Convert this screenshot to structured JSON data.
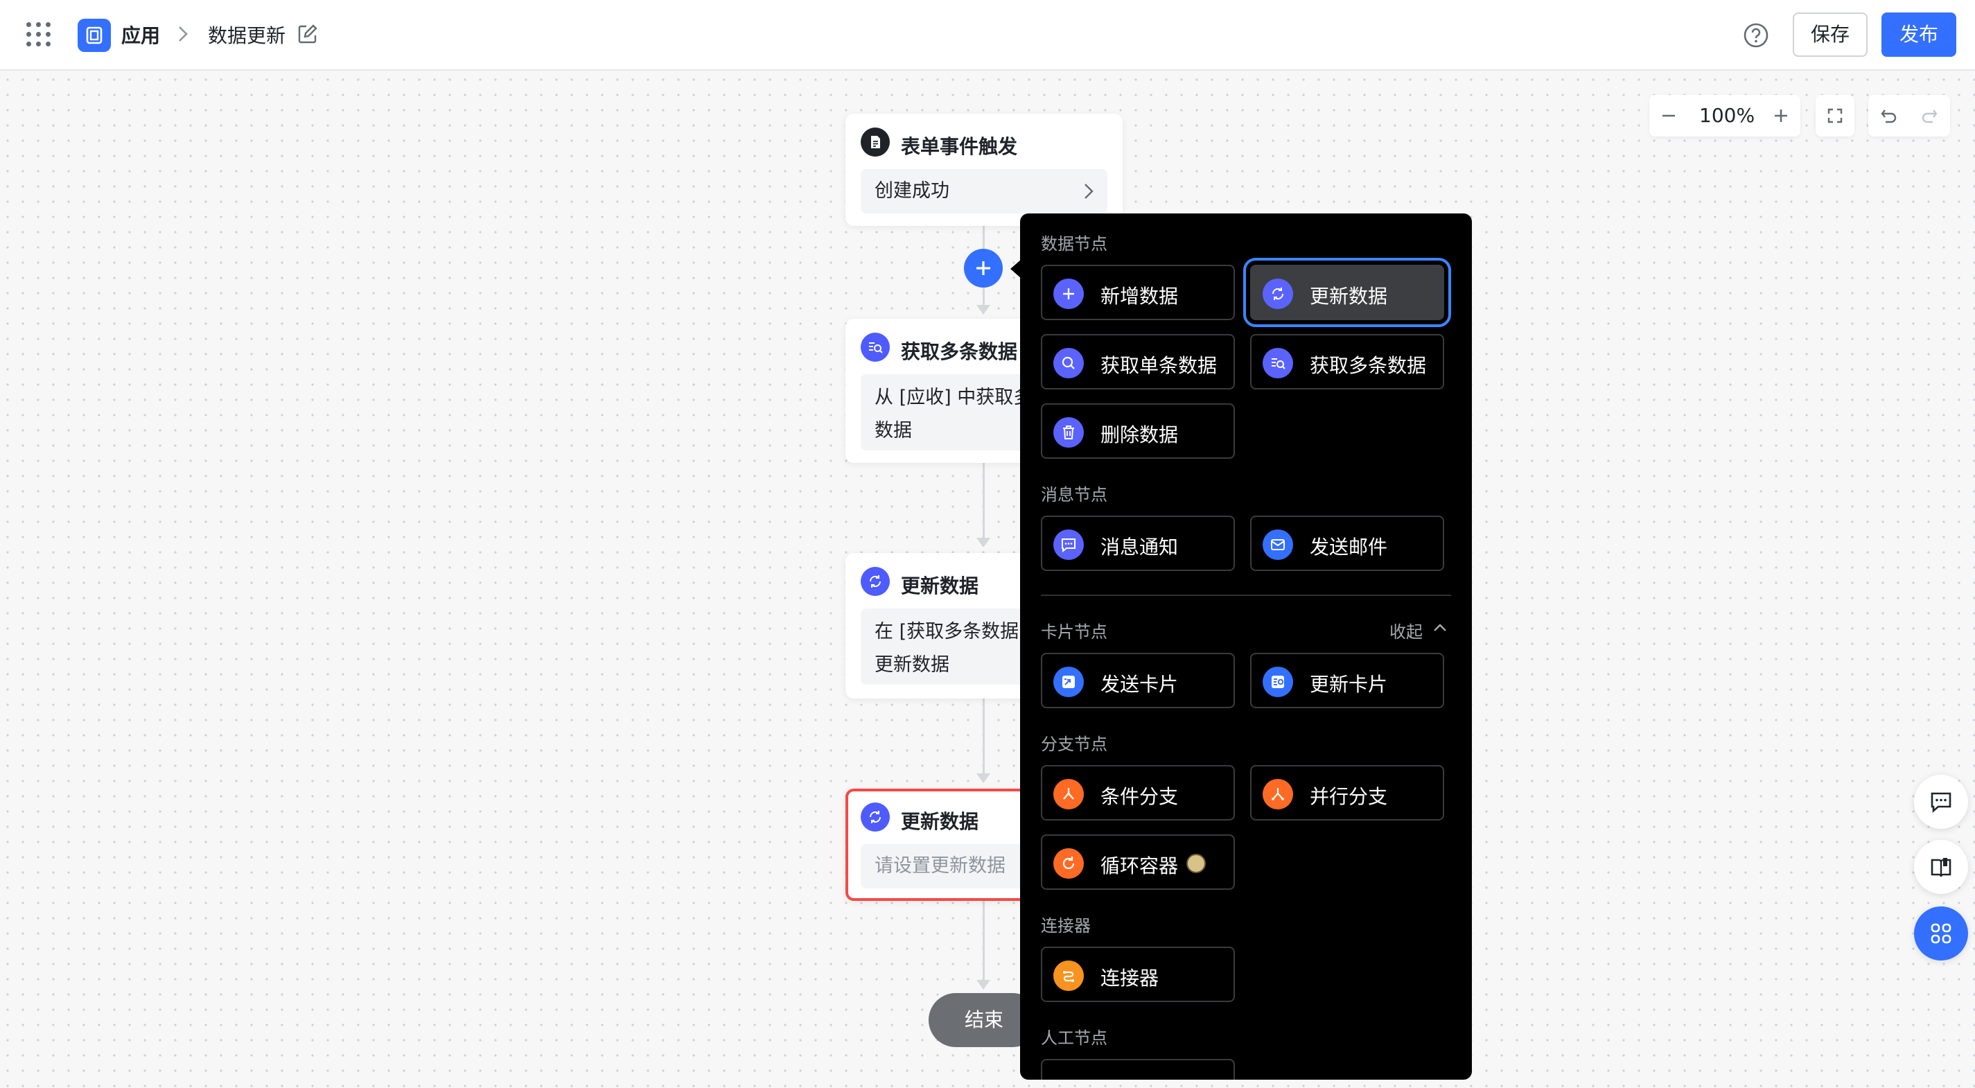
{
  "header": {
    "app_name": "应用",
    "page_name": "数据更新",
    "save_label": "保存",
    "publish_label": "发布"
  },
  "toolbar": {
    "zoom": "100%"
  },
  "flow": {
    "trigger": {
      "title": "表单事件触发",
      "body": "创建成功"
    },
    "get_many": {
      "title": "获取多条数据",
      "body_line1": "从 [应收] 中获取多条",
      "body_line2": "数据"
    },
    "update1": {
      "title": "更新数据",
      "body_line1": "在 [获取多条数据] 中",
      "body_line2": "更新数据"
    },
    "update2": {
      "title": "更新数据",
      "body": "请设置更新数据"
    },
    "end": "结束"
  },
  "popup": {
    "sections": {
      "data": "数据节点",
      "message": "消息节点",
      "card": "卡片节点",
      "collapse": "收起",
      "branch": "分支节点",
      "connector": "连接器",
      "manual": "人工节点"
    },
    "items": {
      "add_data": "新增数据",
      "update_data": "更新数据",
      "get_single": "获取单条数据",
      "get_many": "获取多条数据",
      "delete_data": "删除数据",
      "notify": "消息通知",
      "send_mail": "发送邮件",
      "send_card": "发送卡片",
      "update_card": "更新卡片",
      "condition_branch": "条件分支",
      "parallel_branch": "并行分支",
      "loop_container": "循环容器",
      "connector": "连接器"
    }
  },
  "colors": {
    "accent": "#3370ff",
    "node_icon": "#4e5bff",
    "branch_icon": "#ff6a24",
    "selected_border": "#f54a45",
    "popup_bg": "#000000"
  }
}
